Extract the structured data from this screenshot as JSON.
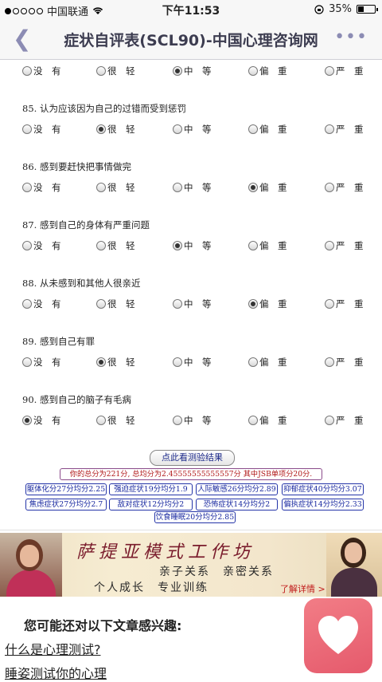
{
  "status_bar": {
    "carrier": "中国联通",
    "time": "下午11:53",
    "battery": "35%"
  },
  "nav": {
    "title": "症状自评表(SCL90)-中国心理咨询网"
  },
  "option_labels": [
    "没　有",
    "很　轻",
    "中　等",
    "偏　重",
    "严　重"
  ],
  "questions": [
    {
      "text": "",
      "selected": 2
    },
    {
      "text": "85. 认为应该因为自己的过错而受到惩罚",
      "selected": 1
    },
    {
      "text": "86. 感到要赶快把事情做完",
      "selected": 3
    },
    {
      "text": "87. 感到自己的身体有严重问题",
      "selected": 2
    },
    {
      "text": "88. 从未感到和其他人很亲近",
      "selected": 3
    },
    {
      "text": "89. 感到自己有罪",
      "selected": 1
    },
    {
      "text": "90. 感到自己的脑子有毛病",
      "selected": 0
    }
  ],
  "result_button": "点此看测验结果",
  "total_text": "你的总分为221分, 总均分为2.45555555555557分 其中JSB单项分20分.",
  "factors": [
    "躯体化分27分均分2.25",
    "强迫症状19分均分1.9",
    "人际敏感26分均分2.89",
    "抑郁症状40分均分3.07",
    "焦虑症状27分均分2.7",
    "敌对症状12分均分2",
    "恐怖症状14分均分2",
    "偏执症状14分均分2.33",
    "饮食睡眠20分均分2.85"
  ],
  "banner": {
    "title": "萨提亚模式工作坊",
    "line1": "亲子关系　亲密关系",
    "line2": "个人成长　专业训练",
    "more": "了解详情 >>"
  },
  "interest_heading": "您可能还对以下文章感兴趣:",
  "articles": [
    "什么是心理测试?",
    "睡姿测试你的心理"
  ],
  "icons": [
    "back-chevron-icon",
    "more-dots-icon",
    "wifi-icon",
    "lock-rotation-icon",
    "battery-icon",
    "heart-icon"
  ],
  "colors": {
    "accent": "#8c8cb4",
    "result_red": "#b01818",
    "factor_blue": "#1a2aa0",
    "fab": "#e8646f"
  }
}
